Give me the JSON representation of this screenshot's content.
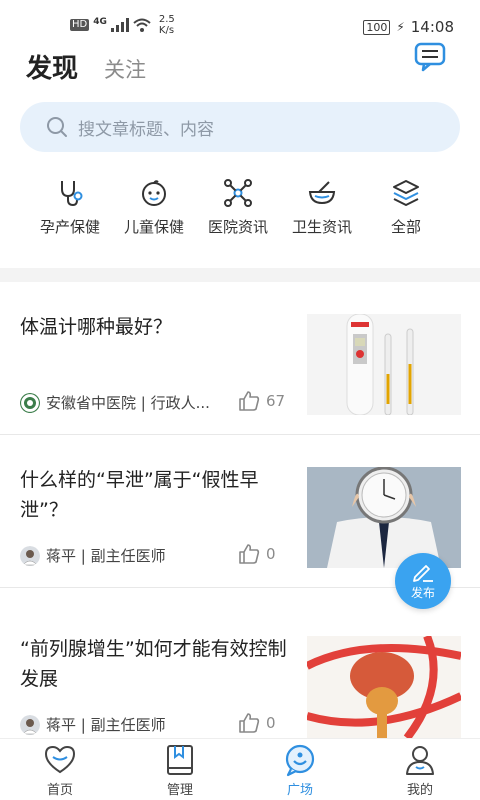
{
  "status_bar": {
    "hd": "HD",
    "network": "4G",
    "speed": "2.5\nK/s",
    "battery": "100",
    "time": "14:08"
  },
  "header": {
    "tab_discover": "发现",
    "tab_follow": "关注"
  },
  "search": {
    "placeholder": "搜文章标题、内容"
  },
  "categories": [
    {
      "label": "孕产保健",
      "icon": "stethoscope-icon"
    },
    {
      "label": "儿童保健",
      "icon": "baby-face-icon"
    },
    {
      "label": "医院资讯",
      "icon": "molecule-icon"
    },
    {
      "label": "卫生资讯",
      "icon": "mortar-bowl-icon"
    },
    {
      "label": "全部",
      "icon": "layers-icon"
    }
  ],
  "articles": [
    {
      "title": "体温计哪种最好？",
      "author": "安徽省中医院 | 行政人...",
      "likes": "67"
    },
    {
      "title": "什么样的“早泄”属于“假性早泄”？",
      "author": "蒋平 | 副主任医师",
      "likes": "0"
    },
    {
      "title": "“前列腺增生”如何才能有效控制发展",
      "author": "蒋平 | 副主任医师",
      "likes": "0"
    }
  ],
  "fab": {
    "label": "发布"
  },
  "nav": [
    {
      "label": "首页"
    },
    {
      "label": "管理"
    },
    {
      "label": "广场"
    },
    {
      "label": "我的"
    }
  ],
  "colors": {
    "accent": "#2f8fe0",
    "search_bg": "#e7f1fb",
    "fab": "#3aa3f0"
  }
}
